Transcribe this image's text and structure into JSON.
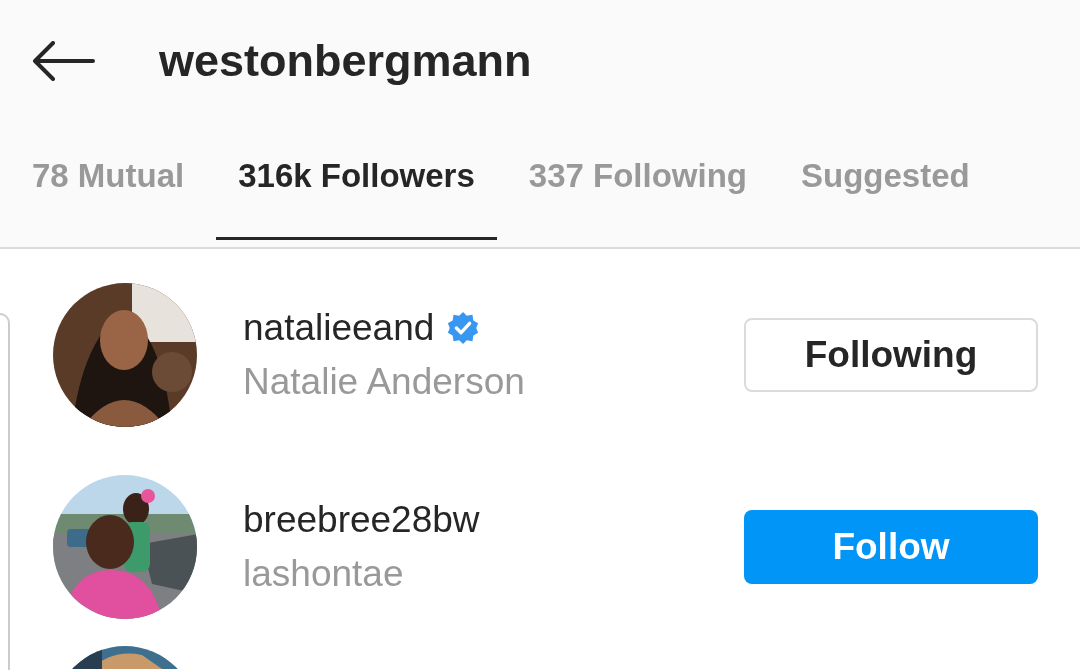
{
  "header": {
    "title": "westonbergmann"
  },
  "tabs": [
    {
      "label": "78 Mutual",
      "selected": false
    },
    {
      "label": "316k Followers",
      "selected": true
    },
    {
      "label": "337 Following",
      "selected": false
    },
    {
      "label": "Suggested",
      "selected": false
    }
  ],
  "users": [
    {
      "username": "natalieeand",
      "verified": true,
      "full_name": "Natalie Anderson",
      "following": true,
      "button": "Following"
    },
    {
      "username": "breebree28bw",
      "verified": false,
      "full_name": "lashontae",
      "following": false,
      "button": "Follow"
    }
  ]
}
